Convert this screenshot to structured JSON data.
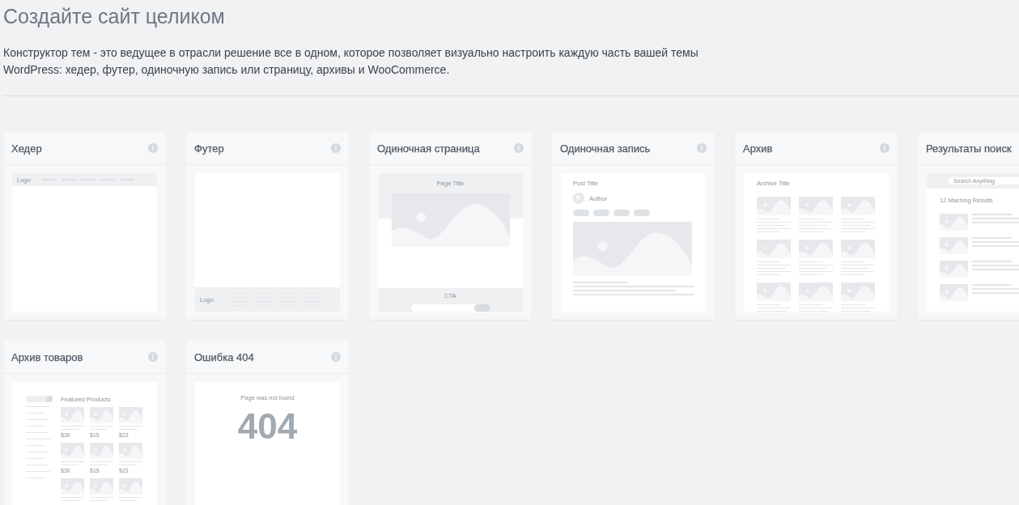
{
  "page": {
    "title": "Создайте сайт целиком",
    "description": "Конструктор тем - это ведущее в отрасли решение все в одном, которое позволяет визуально настроить каждую часть вашей темы WordPress: хедер, футер, одиночную запись или страницу, архивы и WooCommerce."
  },
  "cards": [
    {
      "title": "Хедер",
      "kind": "header",
      "preview": {
        "logo": "Logo"
      }
    },
    {
      "title": "Футер",
      "kind": "footer",
      "preview": {
        "logo": "Logo"
      }
    },
    {
      "title": "Одиночная страница",
      "kind": "page",
      "preview": {
        "title": "Page Title",
        "cta": "CTA"
      }
    },
    {
      "title": "Одиночная запись",
      "kind": "post",
      "preview": {
        "title": "Post Title",
        "author": "Author"
      }
    },
    {
      "title": "Архив",
      "kind": "archive",
      "preview": {
        "title": "Archive Title"
      }
    },
    {
      "title": "Результаты поиск",
      "kind": "search",
      "preview": {
        "search_text": "Search Anything",
        "results": "12 Maching Results"
      }
    },
    {
      "title": "Архив товаров",
      "kind": "products",
      "preview": {
        "title": "Featured Products",
        "prices": [
          "$30",
          "$15",
          "$23",
          "$30",
          "$15",
          "$23"
        ]
      }
    },
    {
      "title": "Ошибка 404",
      "kind": "error",
      "preview": {
        "message": "Page was not found",
        "code": "404"
      }
    }
  ]
}
